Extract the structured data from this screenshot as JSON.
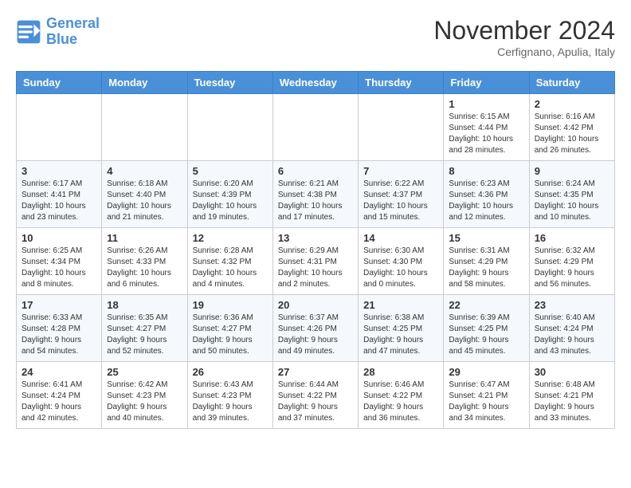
{
  "header": {
    "logo_line1": "General",
    "logo_line2": "Blue",
    "month": "November 2024",
    "location": "Cerfignano, Apulia, Italy"
  },
  "days_of_week": [
    "Sunday",
    "Monday",
    "Tuesday",
    "Wednesday",
    "Thursday",
    "Friday",
    "Saturday"
  ],
  "weeks": [
    [
      {
        "day": "",
        "info": ""
      },
      {
        "day": "",
        "info": ""
      },
      {
        "day": "",
        "info": ""
      },
      {
        "day": "",
        "info": ""
      },
      {
        "day": "",
        "info": ""
      },
      {
        "day": "1",
        "info": "Sunrise: 6:15 AM\nSunset: 4:44 PM\nDaylight: 10 hours and 28 minutes."
      },
      {
        "day": "2",
        "info": "Sunrise: 6:16 AM\nSunset: 4:42 PM\nDaylight: 10 hours and 26 minutes."
      }
    ],
    [
      {
        "day": "3",
        "info": "Sunrise: 6:17 AM\nSunset: 4:41 PM\nDaylight: 10 hours and 23 minutes."
      },
      {
        "day": "4",
        "info": "Sunrise: 6:18 AM\nSunset: 4:40 PM\nDaylight: 10 hours and 21 minutes."
      },
      {
        "day": "5",
        "info": "Sunrise: 6:20 AM\nSunset: 4:39 PM\nDaylight: 10 hours and 19 minutes."
      },
      {
        "day": "6",
        "info": "Sunrise: 6:21 AM\nSunset: 4:38 PM\nDaylight: 10 hours and 17 minutes."
      },
      {
        "day": "7",
        "info": "Sunrise: 6:22 AM\nSunset: 4:37 PM\nDaylight: 10 hours and 15 minutes."
      },
      {
        "day": "8",
        "info": "Sunrise: 6:23 AM\nSunset: 4:36 PM\nDaylight: 10 hours and 12 minutes."
      },
      {
        "day": "9",
        "info": "Sunrise: 6:24 AM\nSunset: 4:35 PM\nDaylight: 10 hours and 10 minutes."
      }
    ],
    [
      {
        "day": "10",
        "info": "Sunrise: 6:25 AM\nSunset: 4:34 PM\nDaylight: 10 hours and 8 minutes."
      },
      {
        "day": "11",
        "info": "Sunrise: 6:26 AM\nSunset: 4:33 PM\nDaylight: 10 hours and 6 minutes."
      },
      {
        "day": "12",
        "info": "Sunrise: 6:28 AM\nSunset: 4:32 PM\nDaylight: 10 hours and 4 minutes."
      },
      {
        "day": "13",
        "info": "Sunrise: 6:29 AM\nSunset: 4:31 PM\nDaylight: 10 hours and 2 minutes."
      },
      {
        "day": "14",
        "info": "Sunrise: 6:30 AM\nSunset: 4:30 PM\nDaylight: 10 hours and 0 minutes."
      },
      {
        "day": "15",
        "info": "Sunrise: 6:31 AM\nSunset: 4:29 PM\nDaylight: 9 hours and 58 minutes."
      },
      {
        "day": "16",
        "info": "Sunrise: 6:32 AM\nSunset: 4:29 PM\nDaylight: 9 hours and 56 minutes."
      }
    ],
    [
      {
        "day": "17",
        "info": "Sunrise: 6:33 AM\nSunset: 4:28 PM\nDaylight: 9 hours and 54 minutes."
      },
      {
        "day": "18",
        "info": "Sunrise: 6:35 AM\nSunset: 4:27 PM\nDaylight: 9 hours and 52 minutes."
      },
      {
        "day": "19",
        "info": "Sunrise: 6:36 AM\nSunset: 4:27 PM\nDaylight: 9 hours and 50 minutes."
      },
      {
        "day": "20",
        "info": "Sunrise: 6:37 AM\nSunset: 4:26 PM\nDaylight: 9 hours and 49 minutes."
      },
      {
        "day": "21",
        "info": "Sunrise: 6:38 AM\nSunset: 4:25 PM\nDaylight: 9 hours and 47 minutes."
      },
      {
        "day": "22",
        "info": "Sunrise: 6:39 AM\nSunset: 4:25 PM\nDaylight: 9 hours and 45 minutes."
      },
      {
        "day": "23",
        "info": "Sunrise: 6:40 AM\nSunset: 4:24 PM\nDaylight: 9 hours and 43 minutes."
      }
    ],
    [
      {
        "day": "24",
        "info": "Sunrise: 6:41 AM\nSunset: 4:24 PM\nDaylight: 9 hours and 42 minutes."
      },
      {
        "day": "25",
        "info": "Sunrise: 6:42 AM\nSunset: 4:23 PM\nDaylight: 9 hours and 40 minutes."
      },
      {
        "day": "26",
        "info": "Sunrise: 6:43 AM\nSunset: 4:23 PM\nDaylight: 9 hours and 39 minutes."
      },
      {
        "day": "27",
        "info": "Sunrise: 6:44 AM\nSunset: 4:22 PM\nDaylight: 9 hours and 37 minutes."
      },
      {
        "day": "28",
        "info": "Sunrise: 6:46 AM\nSunset: 4:22 PM\nDaylight: 9 hours and 36 minutes."
      },
      {
        "day": "29",
        "info": "Sunrise: 6:47 AM\nSunset: 4:21 PM\nDaylight: 9 hours and 34 minutes."
      },
      {
        "day": "30",
        "info": "Sunrise: 6:48 AM\nSunset: 4:21 PM\nDaylight: 9 hours and 33 minutes."
      }
    ]
  ]
}
